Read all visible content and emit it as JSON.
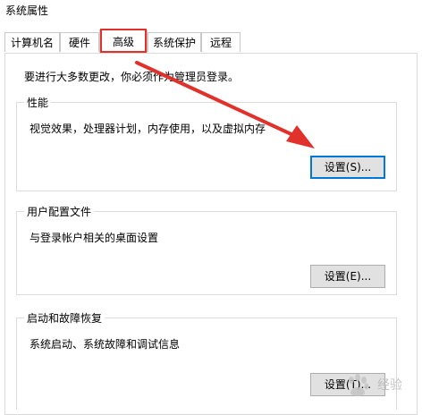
{
  "window": {
    "title": "系统属性"
  },
  "tabs": [
    {
      "label": "计算机名"
    },
    {
      "label": "硬件"
    },
    {
      "label": "高级"
    },
    {
      "label": "系统保护"
    },
    {
      "label": "远程"
    }
  ],
  "notice": "要进行大多数更改，你必须作为管理员登录。",
  "performance": {
    "label": "性能",
    "description": "视觉效果，处理器计划，内存使用，以及虚拟内存",
    "button": "设置(S)..."
  },
  "user_profiles": {
    "label": "用户配置文件",
    "description": "与登录帐户相关的桌面设置",
    "button": "设置(E)..."
  },
  "startup_recovery": {
    "label": "启动和故障恢复",
    "description": "系统启动、系统故障和调试信息",
    "button": "设置(T)..."
  },
  "annotation": {
    "highlight_color": "#e0322b",
    "arrow_color": "#e0322b"
  },
  "watermark": {
    "text": "经验",
    "icon": "baidu-paw-icon"
  }
}
